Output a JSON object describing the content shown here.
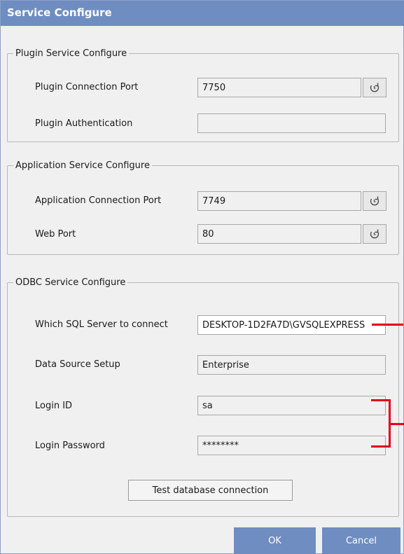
{
  "window": {
    "title": "Service Configure"
  },
  "plugin": {
    "legend": "Plugin Service Configure",
    "port_label": "Plugin Connection Port",
    "port_value": "7750",
    "auth_label": "Plugin Authentication",
    "auth_value": ""
  },
  "application": {
    "legend": "Application Service Configure",
    "port_label": "Application Connection Port",
    "port_value": "7749",
    "web_label": "Web Port",
    "web_value": "80"
  },
  "odbc": {
    "legend": "ODBC Service Configure",
    "server_label": "Which SQL Server to connect",
    "server_value": "DESKTOP-1D2FA7D\\GVSQLEXPRESS",
    "dsn_label": "Data Source Setup",
    "dsn_value": "Enterprise",
    "login_label": "Login ID",
    "login_value": "sa",
    "password_label": "Login Password",
    "password_value": "********",
    "test_button": "Test database connection"
  },
  "footer": {
    "ok": "OK",
    "cancel": "Cancel"
  },
  "icons": {
    "reset": "reset-port-icon"
  },
  "colors": {
    "titlebar": "#6f8dc0",
    "annotation": "#e0001b"
  }
}
